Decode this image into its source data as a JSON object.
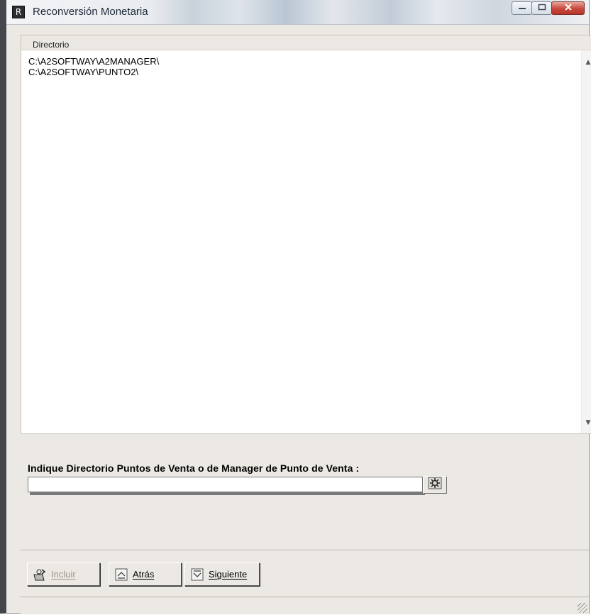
{
  "window": {
    "title": "Reconversión Monetaria",
    "app_icon": "app-icon",
    "controls": {
      "minimize": "minimize-icon",
      "maximize": "maximize-icon",
      "close": "close-icon"
    }
  },
  "directory_panel": {
    "header": "Directorio",
    "items": [
      "C:\\A2SOFTWAY\\A2MANAGER\\",
      "C:\\A2SOFTWAY\\PUNTO2\\"
    ]
  },
  "form": {
    "prompt": "Indique Directorio Puntos de Venta o de Manager de Punto de Venta :",
    "directory_value": "",
    "browse_icon": "folder-browse-icon"
  },
  "buttons": {
    "include": {
      "label": "Incluir",
      "icon": "include-icon",
      "enabled": false
    },
    "back": {
      "label": "Atrás",
      "icon": "back-icon",
      "enabled": true
    },
    "next": {
      "label": "Siguiente",
      "icon": "next-icon",
      "enabled": true
    }
  }
}
